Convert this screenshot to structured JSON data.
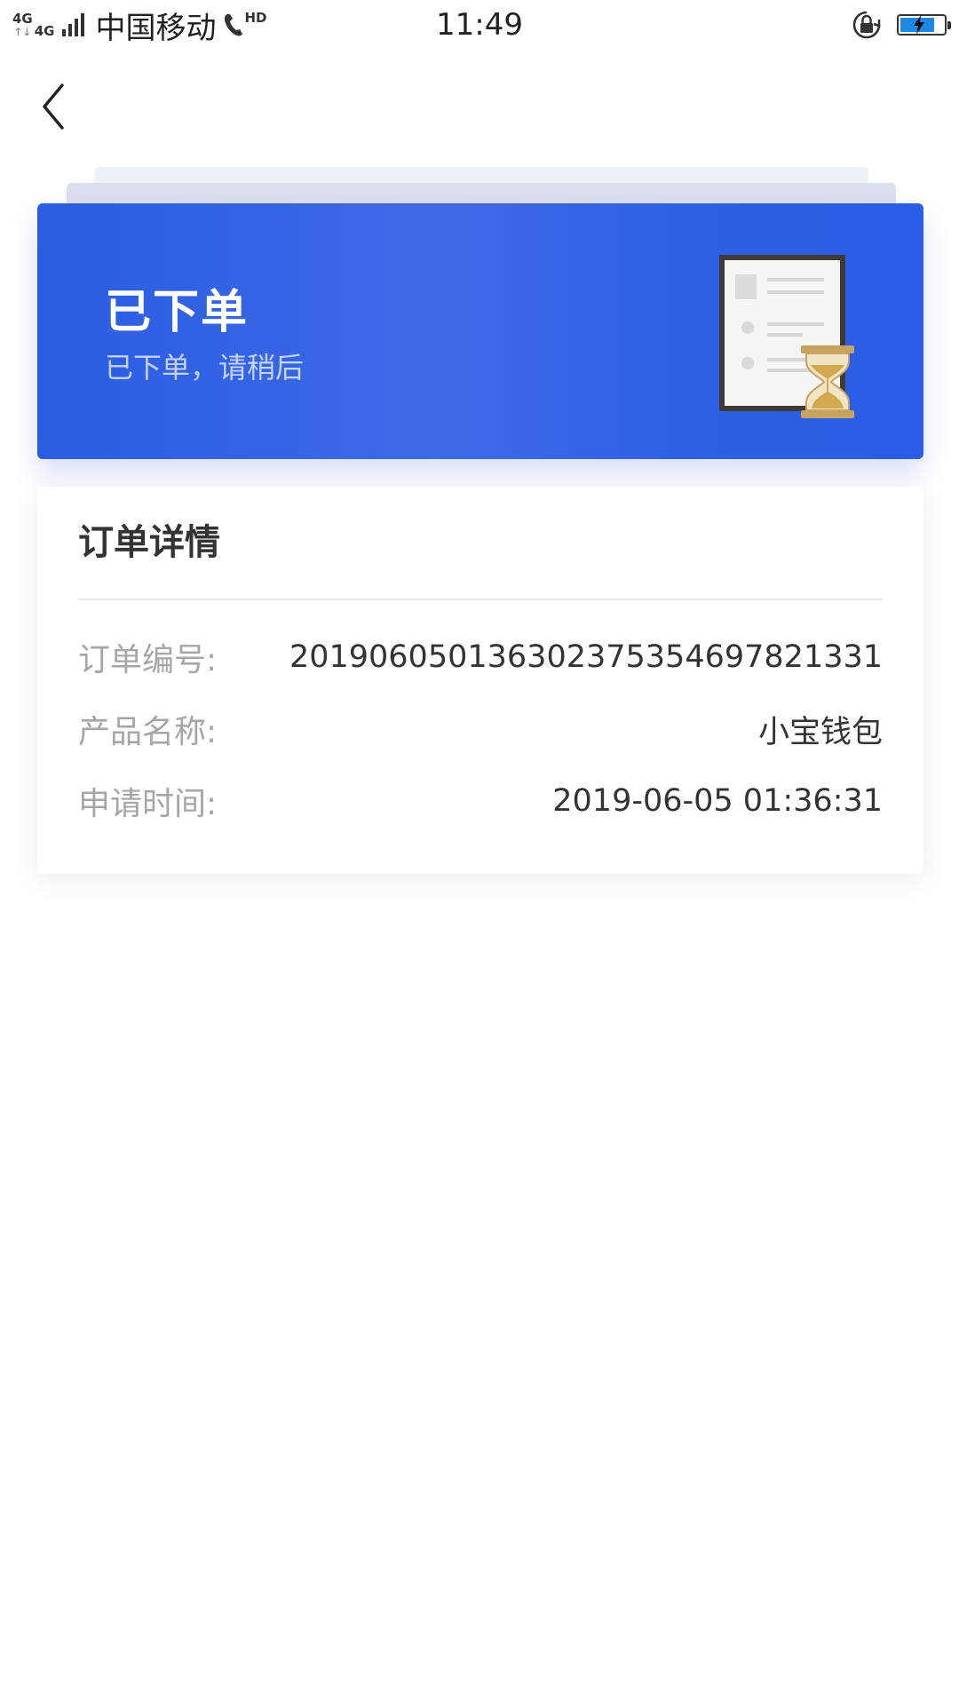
{
  "status_bar": {
    "network_1": "4G",
    "network_2": "4G",
    "network_arrows": "↑↓",
    "carrier": "中国移动",
    "hd_label": "HD",
    "time": "11:49",
    "battery_color": "#1e88e5"
  },
  "nav": {
    "back_icon": "chevron-left-icon"
  },
  "status_card": {
    "title": "已下单",
    "subtitle": "已下单，请稍后",
    "background_color": "#2b5ce2",
    "illustration": "document-hourglass-icon"
  },
  "order_details": {
    "title": "订单详情",
    "rows": [
      {
        "label": "订单编号:",
        "value": "20190605013630237535469782133​1"
      },
      {
        "label": "产品名称:",
        "value": "小宝钱包"
      },
      {
        "label": "申请时间:",
        "value": "2019-06-05 01:36:31"
      }
    ]
  }
}
